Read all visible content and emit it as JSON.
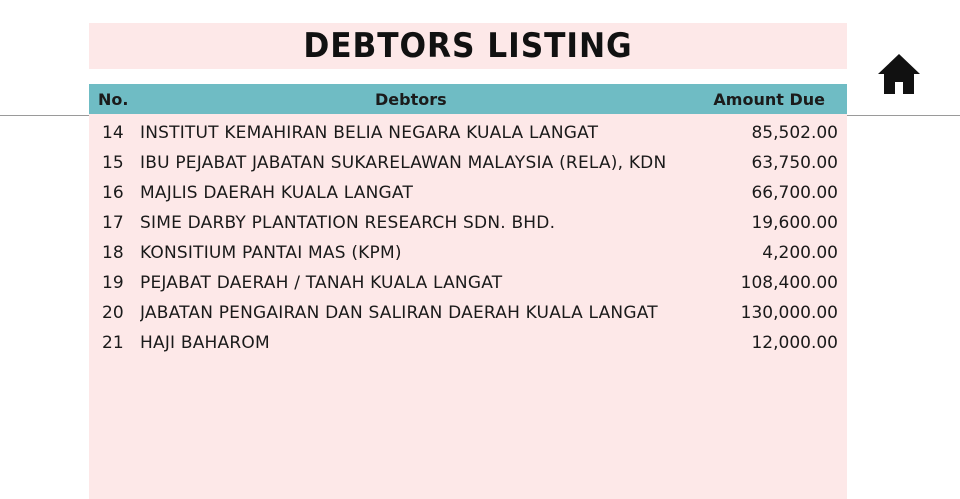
{
  "page": {
    "title": "DEBTORS LISTING"
  },
  "table": {
    "headers": {
      "no": "No.",
      "debtors": "Debtors",
      "amount": "Amount Due"
    },
    "rows": [
      {
        "no": "14",
        "name": "INSTITUT KEMAHIRAN BELIA NEGARA KUALA LANGAT",
        "amount": "85,502.00"
      },
      {
        "no": "15",
        "name": "IBU PEJABAT JABATAN SUKARELAWAN MALAYSIA (RELA), KDN",
        "amount": "63,750.00"
      },
      {
        "no": "16",
        "name": "MAJLIS DAERAH KUALA LANGAT",
        "amount": "66,700.00"
      },
      {
        "no": "17",
        "name": "SIME DARBY PLANTATION RESEARCH SDN. BHD.",
        "amount": "19,600.00"
      },
      {
        "no": "18",
        "name": "KONSITIUM PANTAI MAS (KPM)",
        "amount": "4,200.00"
      },
      {
        "no": "19",
        "name": "PEJABAT DAERAH / TANAH KUALA LANGAT",
        "amount": "108,400.00"
      },
      {
        "no": "20",
        "name": "JABATAN PENGAIRAN DAN SALIRAN DAERAH KUALA LANGAT",
        "amount": "130,000.00"
      },
      {
        "no": "21",
        "name": "HAJI BAHAROM",
        "amount": "12,000.00"
      }
    ]
  },
  "icons": {
    "home": "home-icon"
  },
  "colors": {
    "header_bg": "#6fbcc4",
    "panel_bg": "#fde8e8"
  }
}
